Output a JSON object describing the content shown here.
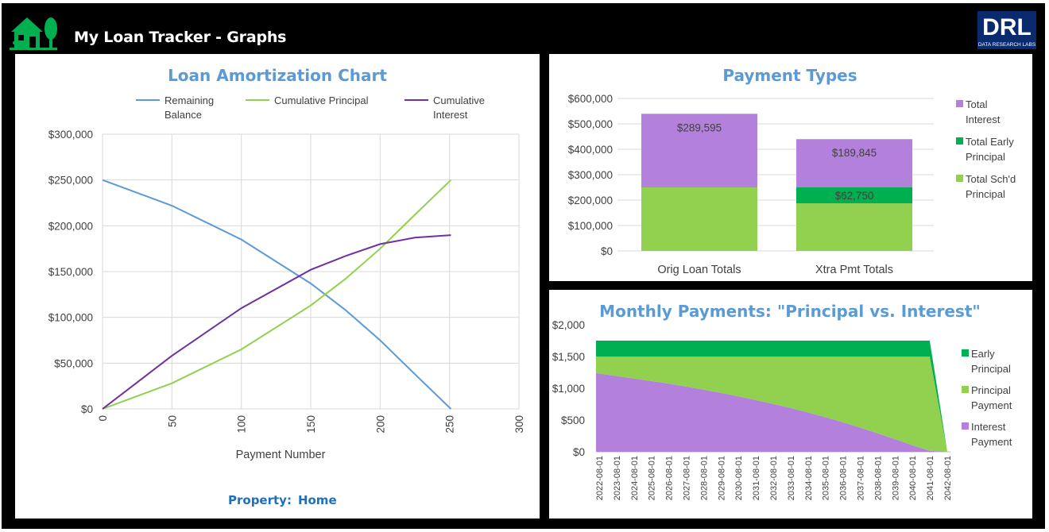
{
  "header": {
    "title": "My Loan Tracker - Graphs",
    "logo_icon": "house-tree-icon",
    "brand_logo": {
      "text": "DRL",
      "subtext": "DATA RESEARCH LABS"
    }
  },
  "colors": {
    "background": "#000000",
    "panel": "#ffffff",
    "title_blue": "#5b9bd5",
    "balance": "#5b9bd5",
    "principal": "#92d050",
    "interest_line": "#7030a0",
    "interest_fill": "#b381dc",
    "early_principal": "#00b050",
    "house_green": "#00b050"
  },
  "property": {
    "label": "Property:",
    "value": "Home"
  },
  "chart_data": [
    {
      "type": "line",
      "title": "Loan Amortization Chart",
      "xlabel": "Payment Number",
      "ylabel": "",
      "xlim": [
        0,
        300
      ],
      "ylim": [
        0,
        300000
      ],
      "xticks": [
        "0",
        "50",
        "100",
        "150",
        "200",
        "250",
        "300"
      ],
      "yticks": [
        "$0",
        "$50,000",
        "$100,000",
        "$150,000",
        "$200,000",
        "$250,000",
        "$300,000"
      ],
      "grid": true,
      "legend": "top",
      "series": [
        {
          "name": "Remaining Balance",
          "x": [
            0,
            50,
            100,
            150,
            175,
            200,
            225,
            251
          ],
          "values": [
            250000,
            222000,
            185000,
            137000,
            108000,
            75000,
            38000,
            0
          ]
        },
        {
          "name": "Cumulative Principal",
          "x": [
            0,
            50,
            100,
            150,
            175,
            200,
            225,
            251
          ],
          "values": [
            0,
            28000,
            65000,
            113000,
            142000,
            175000,
            212000,
            250000
          ]
        },
        {
          "name": "Cumulative Interest",
          "x": [
            0,
            50,
            100,
            150,
            175,
            200,
            225,
            251
          ],
          "values": [
            0,
            58000,
            110000,
            152000,
            167000,
            180000,
            187000,
            189800
          ]
        }
      ]
    },
    {
      "type": "bar",
      "stacked": true,
      "title": "Payment Types",
      "categories": [
        "Orig Loan Totals",
        "Xtra Pmt Totals"
      ],
      "ylim": [
        0,
        600000
      ],
      "yticks": [
        "$0",
        "$100,000",
        "$200,000",
        "$300,000",
        "$400,000",
        "$500,000",
        "$600,000"
      ],
      "grid": true,
      "legend": "right",
      "series": [
        {
          "name": "Total Sch'd Principal",
          "values": [
            250000,
            187250
          ]
        },
        {
          "name": "Total Early Principal",
          "values": [
            0,
            62750
          ]
        },
        {
          "name": "Total Interest",
          "values": [
            289595,
            189845
          ]
        }
      ],
      "data_labels": [
        "$289,595",
        "$189,845",
        "$62,750"
      ]
    },
    {
      "type": "area",
      "stacked": true,
      "title": "Monthly Payments:  \"Principal vs. Interest\"",
      "categories": [
        "2022-08-01",
        "2023-08-01",
        "2024-08-01",
        "2025-08-01",
        "2026-08-01",
        "2027-08-01",
        "2028-08-01",
        "2029-08-01",
        "2030-08-01",
        "2031-08-01",
        "2032-08-01",
        "2033-08-01",
        "2034-08-01",
        "2035-08-01",
        "2036-08-01",
        "2037-08-01",
        "2038-08-01",
        "2039-08-01",
        "2040-08-01",
        "2041-08-01",
        "2042-08-01"
      ],
      "ylim": [
        0,
        2000
      ],
      "yticks": [
        "$0",
        "$500",
        "$1,000",
        "$1,500",
        "$2,000"
      ],
      "legend": "right",
      "series": [
        {
          "name": "Interest Payment",
          "values": [
            1240,
            1200,
            1160,
            1120,
            1080,
            1035,
            985,
            935,
            880,
            820,
            760,
            695,
            625,
            550,
            470,
            385,
            295,
            200,
            105,
            15,
            0
          ]
        },
        {
          "name": "Principal Payment",
          "values": [
            260,
            300,
            340,
            380,
            420,
            465,
            515,
            565,
            620,
            680,
            740,
            805,
            875,
            950,
            1030,
            1115,
            1205,
            1300,
            1395,
            1485,
            0
          ]
        },
        {
          "name": "Early Principal",
          "values": [
            250,
            250,
            250,
            250,
            250,
            250,
            250,
            250,
            250,
            250,
            250,
            250,
            250,
            250,
            250,
            250,
            250,
            250,
            250,
            250,
            0
          ]
        }
      ]
    }
  ]
}
